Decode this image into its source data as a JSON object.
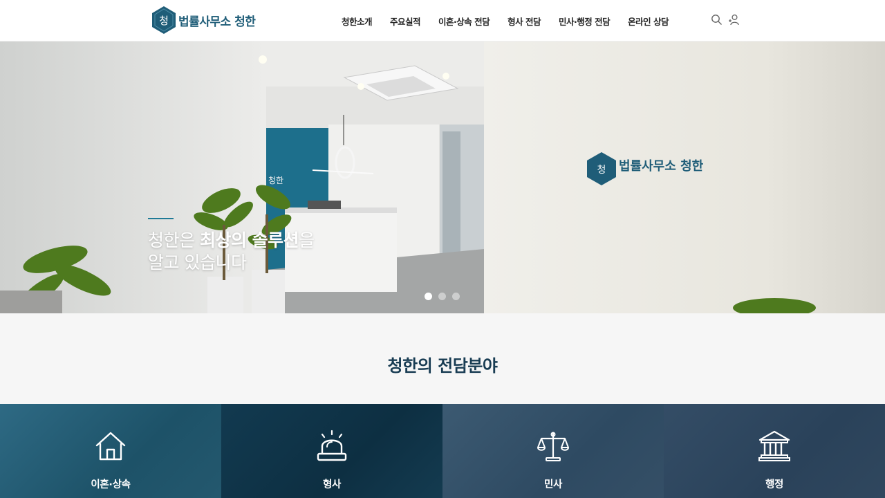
{
  "header": {
    "logo_text": "법률사무소 청한",
    "nav": [
      "청한소개",
      "주요실적",
      "이혼·상속 전담",
      "형사 전담",
      "민사·행정 전담",
      "온라인 상담"
    ],
    "icons": [
      "search-icon",
      "user-icon"
    ]
  },
  "hero": {
    "headline_pre": "청한은 ",
    "headline_bold": "최상의 솔루션",
    "headline_post": "을",
    "headline_line2": "알고 있습니다",
    "wall_sign": "법률사무소 청한",
    "desk_sign": "청한",
    "slides": 3,
    "active_slide": 1
  },
  "section": {
    "title": "청한의 전담분야"
  },
  "practice_areas": [
    {
      "label": "이혼·상속",
      "icon": "house-icon"
    },
    {
      "label": "형사",
      "icon": "siren-icon"
    },
    {
      "label": "민사",
      "icon": "scales-icon"
    },
    {
      "label": "행정",
      "icon": "government-building-icon"
    }
  ],
  "colors": {
    "brand": "#1f5d78",
    "title": "#183c53",
    "accent_line": "#1f7a96"
  }
}
